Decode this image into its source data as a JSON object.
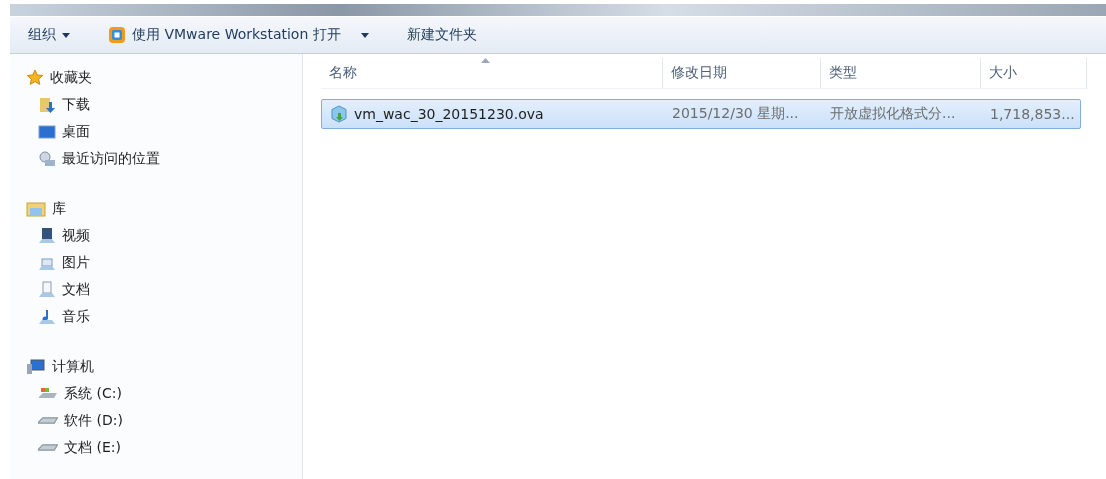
{
  "toolbar": {
    "items": [
      {
        "label": "组织",
        "kind": "menu"
      },
      {
        "label": "使用 VMware Workstation 打开",
        "kind": "app-menu"
      },
      {
        "label": "新建文件夹",
        "kind": "plain"
      }
    ]
  },
  "sidebar": {
    "groups": [
      {
        "label": "收藏夹",
        "kind": "star",
        "children": [
          {
            "label": "下载",
            "kind": "download"
          },
          {
            "label": "桌面",
            "kind": "desktop"
          },
          {
            "label": "最近访问的位置",
            "kind": "recent"
          }
        ]
      },
      {
        "label": "库",
        "kind": "library",
        "children": [
          {
            "label": "视频",
            "kind": "video"
          },
          {
            "label": "图片",
            "kind": "picture"
          },
          {
            "label": "文档",
            "kind": "document"
          },
          {
            "label": "音乐",
            "kind": "music"
          }
        ]
      },
      {
        "label": "计算机",
        "kind": "computer",
        "children": [
          {
            "label": "系统 (C:)",
            "kind": "system-drive"
          },
          {
            "label": "软件 (D:)",
            "kind": "drive"
          },
          {
            "label": "文档 (E:)",
            "kind": "drive"
          }
        ]
      }
    ]
  },
  "table": {
    "columns": [
      {
        "label": "名称",
        "sorted": true
      },
      {
        "label": "修改日期",
        "sorted": false
      },
      {
        "label": "类型",
        "sorted": false
      },
      {
        "label": "大小",
        "sorted": false
      }
    ],
    "rows": [
      {
        "selected": true,
        "cells": [
          "vm_wac_30_20151230.ova",
          "2015/12/30 星期...",
          "开放虚拟化格式分...",
          "1,718,853..."
        ]
      }
    ]
  }
}
